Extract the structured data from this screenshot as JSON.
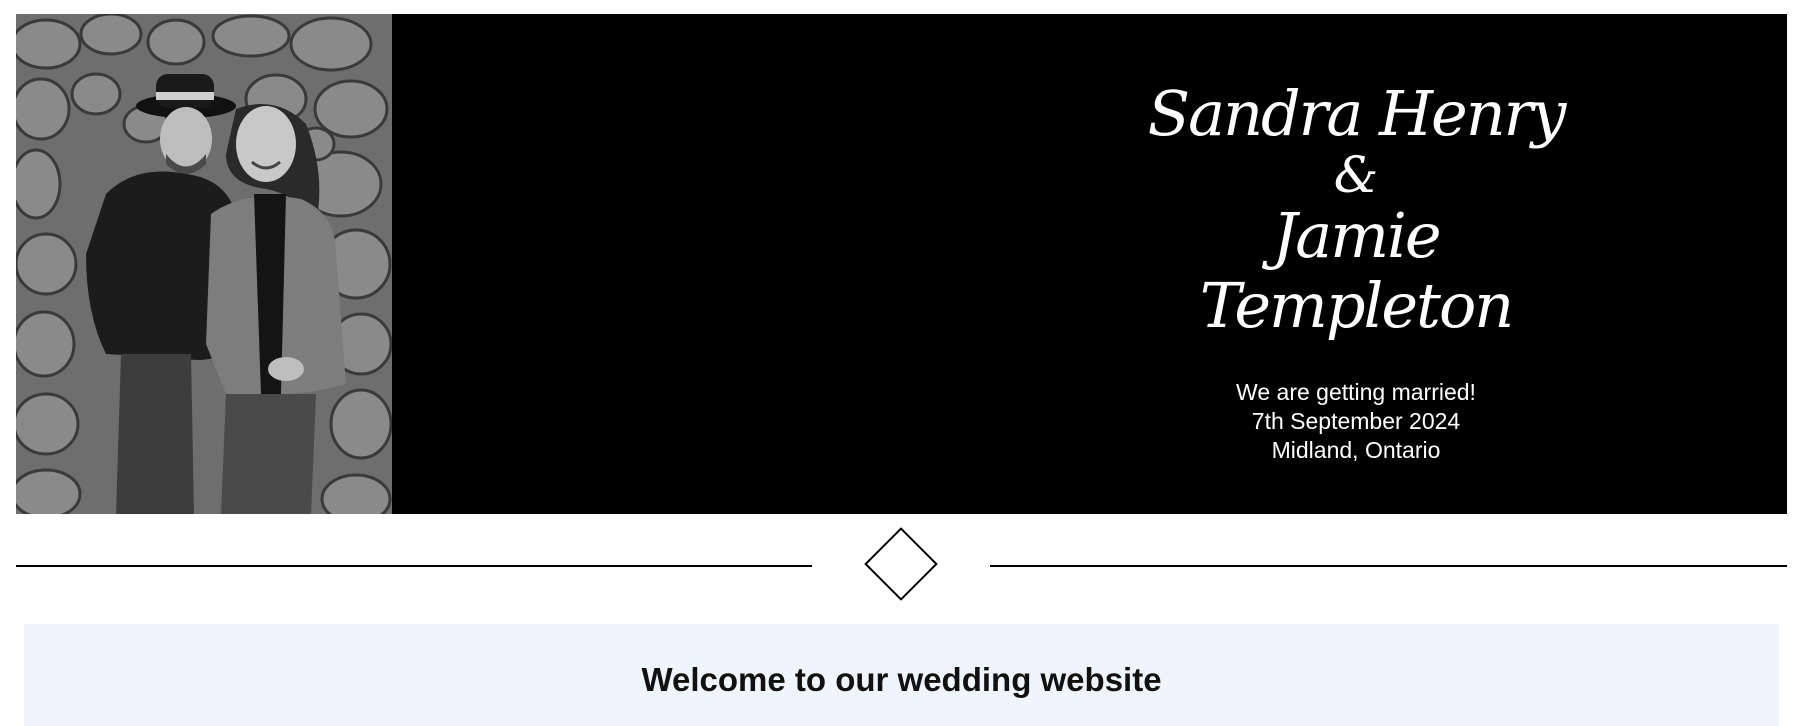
{
  "hero": {
    "photo_alt": "Couple photo in front of stone wall",
    "name_one": "Sandra Henry",
    "ampersand": "&",
    "name_two": "Jamie Templeton",
    "announcement": "We are getting married!",
    "date": "7th September 2024",
    "location": "Midland, Ontario"
  },
  "welcome": {
    "title": "Welcome to our wedding website"
  },
  "colors": {
    "hero_background": "#000000",
    "hero_text": "#ffffff",
    "welcome_background": "#eef5fc",
    "divider": "#000000"
  }
}
